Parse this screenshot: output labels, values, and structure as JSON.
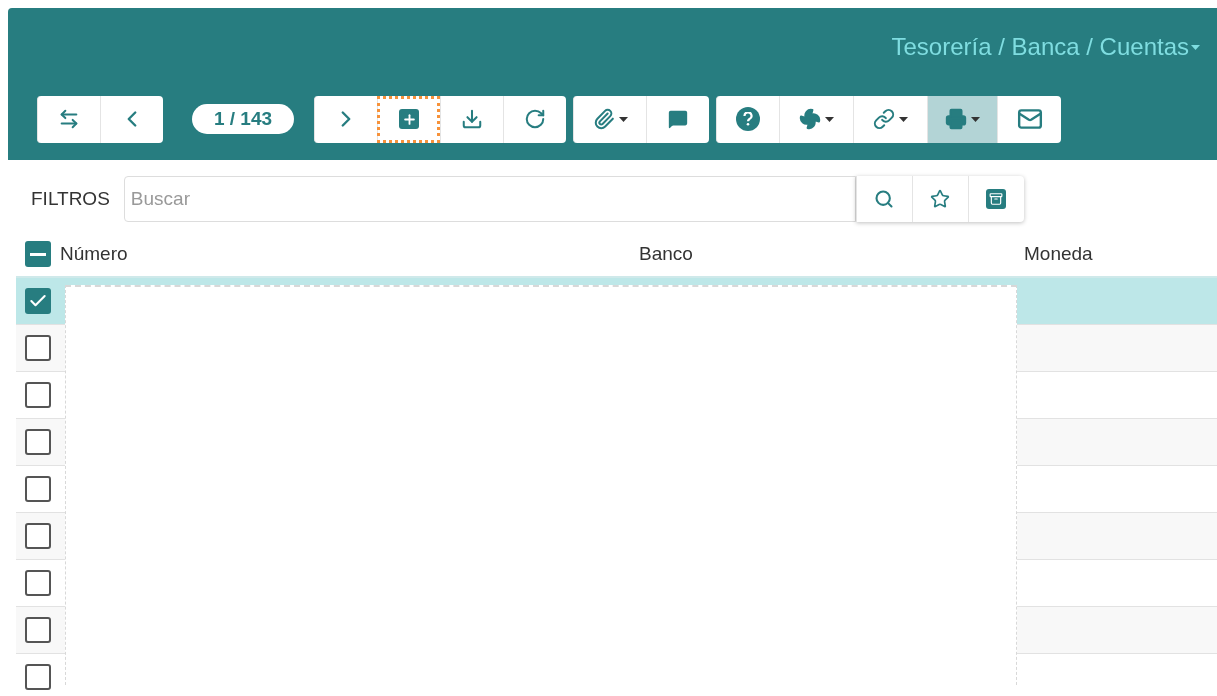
{
  "header": {
    "breadcrumb": "Tesorería / Banca / Cuentas",
    "breadcrumb_dropdown": true
  },
  "toolbar": {
    "groups": [
      {
        "buttons": [
          {
            "kind": "swap",
            "dropdown": false,
            "selected": false,
            "focused": false
          },
          {
            "kind": "prev",
            "dropdown": false,
            "selected": false,
            "focused": false
          }
        ]
      },
      {
        "pager": "1 / 143"
      },
      {
        "buttons": [
          {
            "kind": "next",
            "dropdown": false,
            "selected": false,
            "focused": false
          },
          {
            "kind": "add",
            "dropdown": false,
            "selected": false,
            "focused": true
          },
          {
            "kind": "download",
            "dropdown": false,
            "selected": false,
            "focused": false
          },
          {
            "kind": "refresh",
            "dropdown": false,
            "selected": false,
            "focused": false
          }
        ]
      },
      {
        "buttons": [
          {
            "kind": "attach",
            "dropdown": true,
            "selected": false,
            "focused": false
          },
          {
            "kind": "comment",
            "dropdown": false,
            "selected": false,
            "focused": false
          }
        ]
      },
      {
        "buttons": [
          {
            "kind": "help",
            "dropdown": false,
            "selected": false,
            "focused": false
          },
          {
            "kind": "fan",
            "dropdown": true,
            "selected": false,
            "focused": false
          },
          {
            "kind": "link",
            "dropdown": true,
            "selected": false,
            "focused": false
          },
          {
            "kind": "print",
            "dropdown": true,
            "selected": true,
            "focused": false
          },
          {
            "kind": "mail",
            "dropdown": false,
            "selected": false,
            "focused": false
          }
        ]
      }
    ]
  },
  "filters": {
    "label": "FILTROS",
    "placeholder": "Buscar",
    "buttons": [
      {
        "kind": "search"
      },
      {
        "kind": "star"
      },
      {
        "kind": "archive"
      }
    ]
  },
  "table": {
    "header_indeterminate": true,
    "columns": [
      "Número",
      "Banco",
      "Moneda"
    ],
    "rows": [
      {
        "checked": true,
        "selected": true
      },
      {
        "checked": false,
        "selected": false
      },
      {
        "checked": false,
        "selected": false
      },
      {
        "checked": false,
        "selected": false
      },
      {
        "checked": false,
        "selected": false
      },
      {
        "checked": false,
        "selected": false
      },
      {
        "checked": false,
        "selected": false
      },
      {
        "checked": false,
        "selected": false
      },
      {
        "checked": false,
        "selected": false
      }
    ]
  }
}
